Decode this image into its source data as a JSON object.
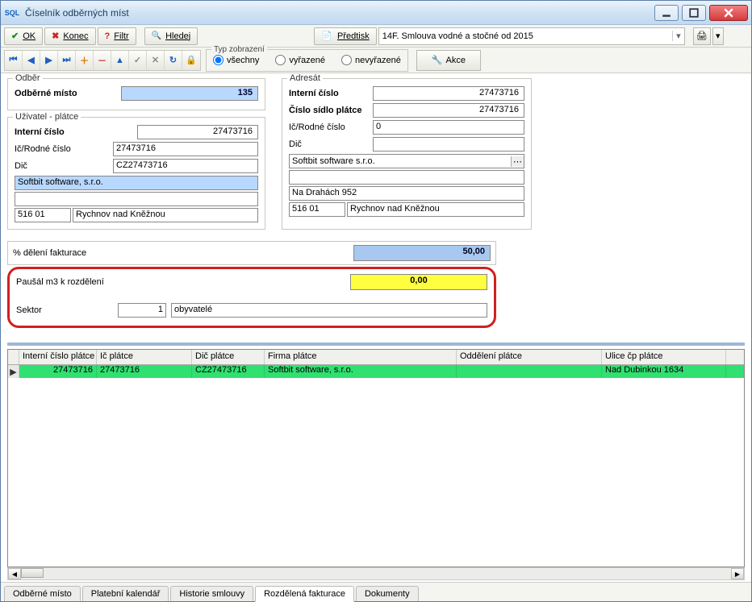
{
  "window": {
    "title": "Číselník odběrných míst"
  },
  "toolbar": {
    "ok": "OK",
    "konec": "Konec",
    "filtr": "Filtr",
    "hledej": "Hledej",
    "predtisk": "Předtisk",
    "dropdown_value": "14F. Smlouva vodné a stočné od 2015"
  },
  "view_type": {
    "label": "Typ zobrazení",
    "all": "všechny",
    "removed": "vyřazené",
    "active": "nevyřazené"
  },
  "akce": "Akce",
  "odber": {
    "legend": "Odběr",
    "misto_label": "Odběrné místo",
    "misto_value": "135"
  },
  "uzivatel": {
    "legend": "Uživatel - plátce",
    "interni_label": "Interní číslo",
    "interni_value": "27473716",
    "icrodne_label": "Ič/Rodné číslo",
    "icrodne_value": "27473716",
    "dic_label": "Dič",
    "dic_value": "CZ27473716",
    "company": "Softbit software, s.r.o.",
    "blank": "",
    "zip": "516 01",
    "city": "Rychnov nad Kněžnou"
  },
  "adresat": {
    "legend": "Adresát",
    "interni_label": "Interní číslo",
    "interni_value": "27473716",
    "sidlo_label": "Číslo sídlo plátce",
    "sidlo_value": "27473716",
    "icrodne_label": "Ič/Rodné číslo",
    "icrodne_value": "0",
    "dic_label": "Dič",
    "dic_value": "",
    "company": "Softbit software s.r.o.",
    "blank": "",
    "street": "Na Drahách 952",
    "zip": "516 01",
    "city": "Rychnov nad Kněžnou"
  },
  "mid": {
    "deleni_label": "% dělení fakturace",
    "deleni_value": "50,00",
    "pausal_label": "Paušál m3 k rozdělení",
    "pausal_value": "0,00",
    "sektor_label": "Sektor",
    "sektor_num": "1",
    "sektor_text": "obyvatelé"
  },
  "grid": {
    "headers": [
      "Interní číslo plátce",
      "Ič plátce",
      "Dič plátce",
      "Firma plátce",
      "Oddělení plátce",
      "Ulice čp plátce"
    ],
    "row": [
      "27473716",
      "27473716",
      "CZ27473716",
      "Softbit software, s.r.o.",
      "",
      "Nad Dubinkou 1634"
    ]
  },
  "tabs": [
    "Odběrné místo",
    "Platební kalendář",
    "Historie smlouvy",
    "Rozdělená fakturace",
    "Dokumenty"
  ]
}
